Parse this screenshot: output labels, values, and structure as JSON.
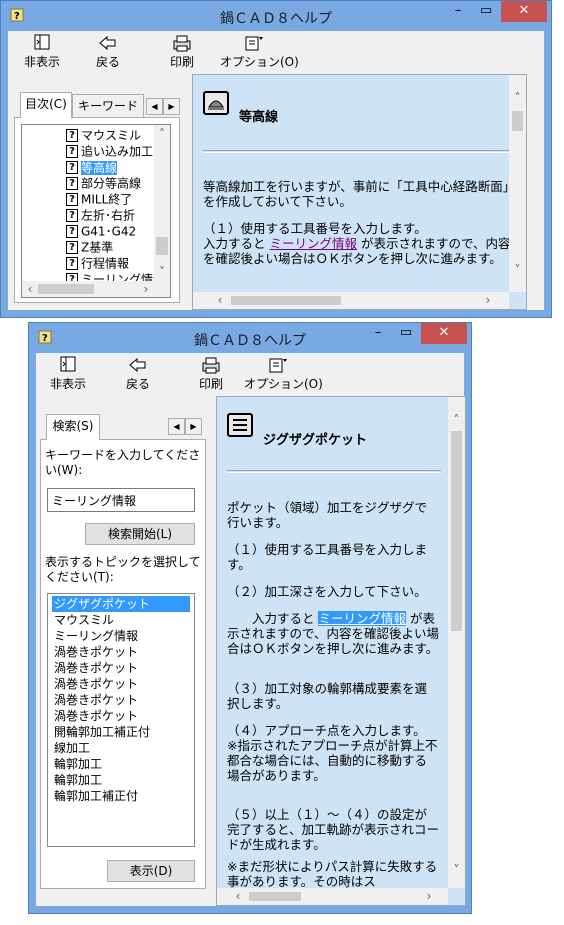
{
  "win1": {
    "title": "鍋ＣＡＤ８ヘルプ",
    "toolbar": {
      "hide": "非表示",
      "back": "戻る",
      "print": "印刷",
      "options": "オプション(O)"
    },
    "tabs": {
      "contents": "目次(C)",
      "keyword": "キーワード"
    },
    "tree": [
      "マウスミル",
      "追い込み加工",
      "等高線",
      "部分等高線",
      "MILL終了",
      "左折･右折",
      "G41･G42",
      "Z基準",
      "行程情報",
      "ミーリング情報"
    ],
    "selected_index": 2,
    "content": {
      "heading": "等高線",
      "para1": "等高線加工を行いますが、事前に「工具中心経路断面」を作成しておいて下さい。",
      "para2a": "（１）使用する工具番号を入力します。",
      "para2b_pre": "入力すると ",
      "para2b_link": "ミーリング情報",
      "para2b_post": " が表示されますので、内容を確認後よい場合はＯＫボタンを押し次に進みます。"
    }
  },
  "win2": {
    "title": "鍋ＣＡＤ８ヘルプ",
    "toolbar": {
      "hide": "非表示",
      "back": "戻る",
      "print": "印刷",
      "options": "オプション(O)"
    },
    "tabs": {
      "search": "検索(S)"
    },
    "keyword_label": "キーワードを入力してください(W):",
    "keyword_value": "ミーリング情報",
    "search_button": "検索開始(L)",
    "topic_label": "表示するトピックを選択してください(T):",
    "results": [
      "ジグザグポケット",
      "マウスミル",
      "ミーリング情報",
      "渦巻きポケット",
      "渦巻きポケット",
      "渦巻きポケット",
      "渦巻きポケット",
      "渦巻きポケット",
      "開輪郭加工補正付",
      "線加工",
      "輪郭加工",
      "輪郭加工",
      "輪郭加工補正付"
    ],
    "display_button": "表示(D)",
    "content": {
      "heading": "ジグザグポケット",
      "p1": "ポケット（領域）加工をジグザグで行います。",
      "p2": "（１）使用する工具番号を入力します。",
      "p3": "（２）加工深さを入力して下さい。",
      "p4_pre": "　　入力すると ",
      "p4_link": "ミーリング情報",
      "p4_post": " が表示されますので、内容を確認後よい場合はＯＫボタンを押し次に進みます。",
      "p5": "（３）加工対象の輪郭構成要素を選択します。",
      "p6": "（４）アプローチ点を入力します。　　※指示されたアプローチ点が計算上不都合な場合には、自動的に移動する場合があります。",
      "p7": "（５）以上（１）～（４）の設定が完了すると、加工軌跡が表示されコードが生成れます。",
      "p8": "※まだ形状によりパス計算に失敗する事があります。その時はス"
    }
  },
  "colors": {
    "frame": "#79a9e3",
    "content_bg": "#cfe3f7",
    "selection": "#3399ff",
    "close": "#c75050"
  }
}
